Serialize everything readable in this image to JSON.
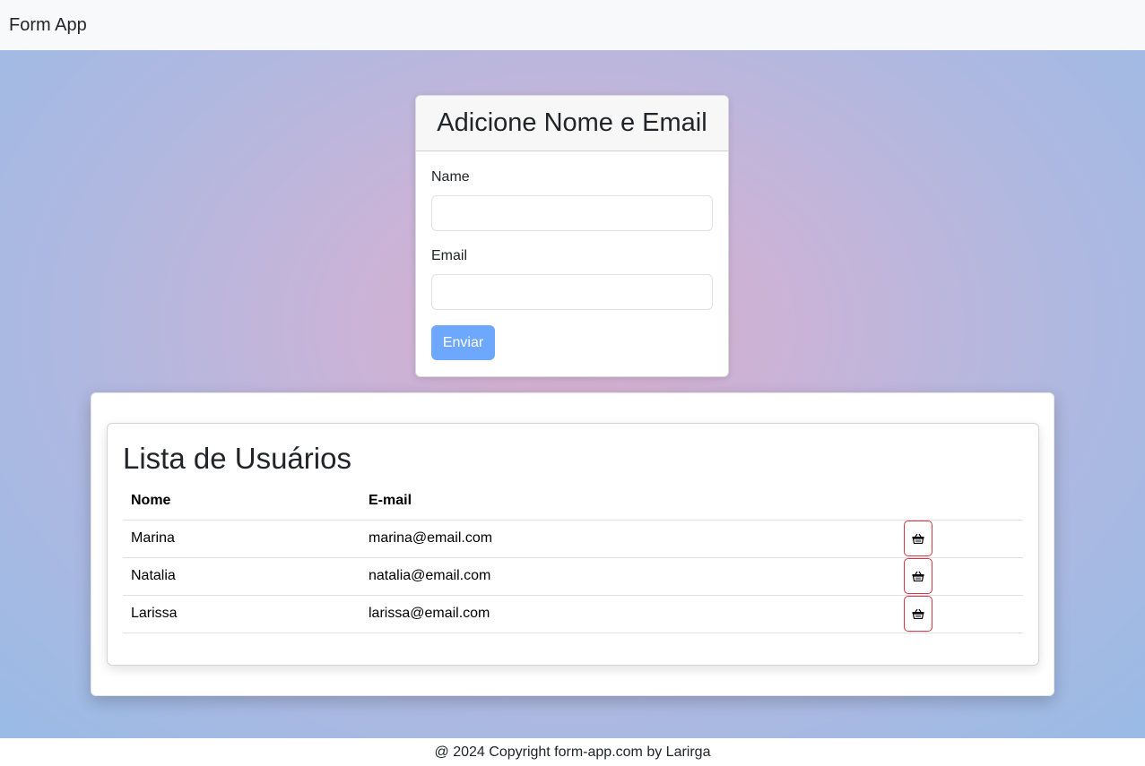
{
  "navbar": {
    "brand": "Form App"
  },
  "form": {
    "title": "Adicione Nome e Email",
    "name_label": "Name",
    "name_value": "",
    "email_label": "Email",
    "email_value": "",
    "submit_label": "Enviar"
  },
  "users": {
    "title": "Lista de Usuários",
    "columns": [
      "Nome",
      "E-mail"
    ],
    "rows": [
      {
        "name": "Marina",
        "email": "marina@email.com",
        "action_icon": "basket-icon"
      },
      {
        "name": "Natalia",
        "email": "natalia@email.com",
        "action_icon": "basket-icon"
      },
      {
        "name": "Larissa",
        "email": "larissa@email.com",
        "action_icon": "basket-icon"
      }
    ]
  },
  "footer": {
    "text": "@ 2024 Copyright form-app.com by Larirga"
  },
  "colors": {
    "submit_button": "#6ea8fe",
    "delete_border": "#dc3545",
    "navbar_bg": "#f8f9fa"
  }
}
